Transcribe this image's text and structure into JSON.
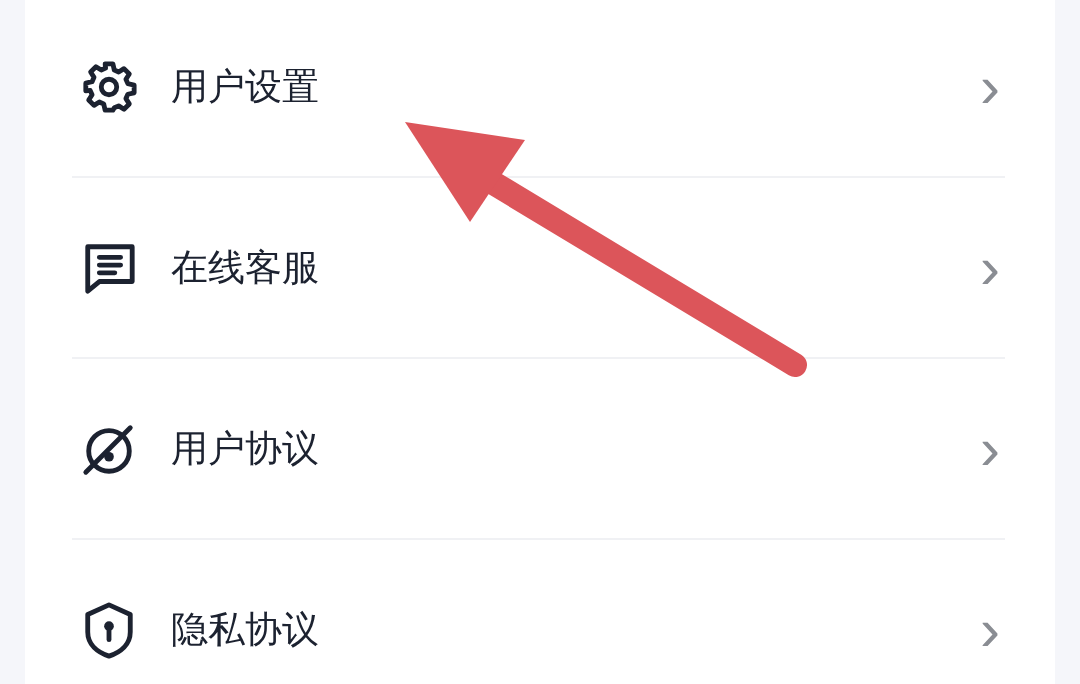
{
  "menu": {
    "items": [
      {
        "label": "用户设置",
        "chevron": "›"
      },
      {
        "label": "在线客服",
        "chevron": "›"
      },
      {
        "label": "用户协议",
        "chevron": "›"
      },
      {
        "label": "隐私协议",
        "chevron": "›"
      }
    ]
  }
}
